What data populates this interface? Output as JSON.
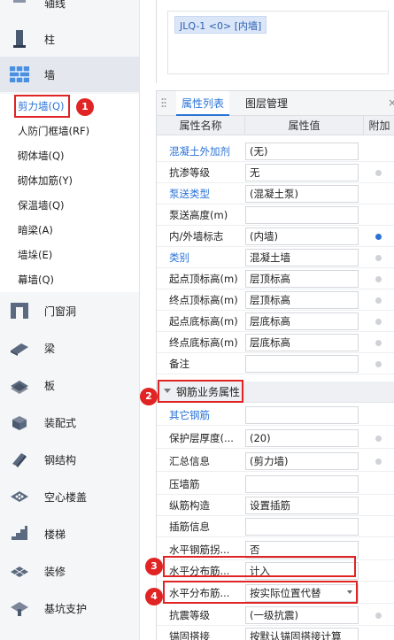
{
  "sidebar": {
    "partial_top": "轴线",
    "column": "柱",
    "wall": "墙",
    "wall_subitems": [
      "剪力墙(Q)",
      "人防门框墙(RF)",
      "砌体墙(Q)",
      "砌体加筋(Y)",
      "保温墙(Q)",
      "暗梁(A)",
      "墙垛(E)",
      "幕墙(Q)"
    ],
    "door_window": "门窗洞",
    "beam": "梁",
    "slab": "板",
    "prefab": "装配式",
    "steel": "钢结构",
    "hollow_slab": "空心楼盖",
    "stairs": "楼梯",
    "decoration": "装修",
    "pit_support": "基坑支护"
  },
  "top_panel": {
    "floor_tag": "JLQ-1 <0> [内墙]"
  },
  "property_panel": {
    "tabs": [
      "属性列表",
      "图层管理"
    ],
    "close": "×",
    "headers": {
      "name": "属性名称",
      "value": "属性值",
      "extra": "附加"
    },
    "rows": [
      {
        "name": "混凝土外加剂",
        "value": "(无)"
      },
      {
        "name": "抗渗等级",
        "value": "无"
      },
      {
        "name": "泵送类型",
        "value": "(混凝土泵)"
      },
      {
        "name": "泵送高度(m)",
        "value": ""
      },
      {
        "name": "内/外墙标志",
        "value": "(内墙)"
      },
      {
        "name": "类别",
        "value": "混凝土墙"
      },
      {
        "name": "起点顶标高(m)",
        "value": "层顶标高"
      },
      {
        "name": "终点顶标高(m)",
        "value": "层顶标高"
      },
      {
        "name": "起点底标高(m)",
        "value": "层底标高"
      },
      {
        "name": "终点底标高(m)",
        "value": "层底标高"
      },
      {
        "name": "备注",
        "value": ""
      }
    ],
    "group_rebar": "钢筋业务属性",
    "rebar_rows": [
      {
        "name": "其它钢筋",
        "value": ""
      },
      {
        "name": "保护层厚度(...",
        "value": "(20)"
      },
      {
        "name": "汇总信息",
        "value": "(剪力墙)"
      },
      {
        "name": "压墙筋",
        "value": ""
      },
      {
        "name": "纵筋构造",
        "value": "设置插筋"
      },
      {
        "name": "插筋信息",
        "value": ""
      },
      {
        "name": "水平钢筋拐...",
        "value": "否"
      },
      {
        "name": "水平分布筋...",
        "value": "计入"
      },
      {
        "name": "水平分布筋...",
        "value": "按实际位置代替"
      },
      {
        "name": "抗震等级",
        "value": "(一级抗震)"
      },
      {
        "name": "锚固搭接",
        "value": "按默认锚固搭接计算"
      }
    ]
  },
  "annotations": [
    "1",
    "2",
    "3",
    "4"
  ],
  "colors": {
    "accent": "#2a73d6",
    "annotation": "#e02424"
  }
}
